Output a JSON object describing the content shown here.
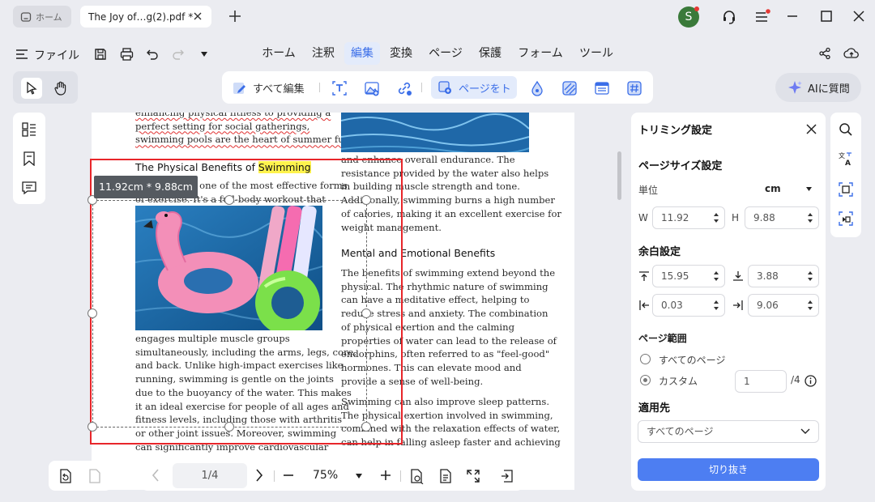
{
  "tabs": {
    "home_label": "ホーム",
    "doc_label": "The Joy of…g(2).pdf *"
  },
  "header": {
    "avatar_letter": "S",
    "accent": "#3b6ee8",
    "avatar_color": "#3a7a3a"
  },
  "file_menu_label": "ファイル",
  "menu": [
    "ホーム",
    "注釈",
    "編集",
    "変換",
    "ページ",
    "保護",
    "フォーム",
    "ツール"
  ],
  "active_menu": "編集",
  "toolbar": {
    "edit_all_label": "すべて編集",
    "page_crop_label": "ページをト"
  },
  "ai_button_label": "AIに質問",
  "document": {
    "col1_top": [
      "enhancing physical fitness to providing a",
      "perfect setting for social gatherings,",
      "swimming pools are the heart of summer fun."
    ],
    "heading1_prefix": "The Physical Benefits of ",
    "heading1_highlight": "Swimming",
    "col1_mid": [
      "Swimming is one of the most effective forms",
      "of exercise. It's a full-body workout that"
    ],
    "col1_bottom": [
      "engages multiple muscle groups",
      "simultaneously, including the arms, legs, core,",
      "and back. Unlike high-impact exercises like",
      "running, swimming is gentle on the joints",
      "due to the buoyancy of the water. This makes",
      "it an ideal exercise for people of all ages and",
      "fitness levels, including those with arthritis",
      "or other joint issues. Moreover, swimming",
      "can significantly improve cardiovascular"
    ],
    "col2_top": [
      "and enhance overall endurance. The",
      "resistance provided by the water also helps",
      "in building muscle strength and tone.",
      "Additionally, swimming burns a high number",
      "of calories, making it an excellent exercise for",
      "weight management."
    ],
    "heading2": "Mental and Emotional Benefits",
    "col2_mid": [
      "The benefits of swimming extend beyond the",
      "physical. The rhythmic nature of swimming",
      "can have a meditative effect, helping to",
      "reduce stress and anxiety. The combination",
      "of physical exertion and the calming",
      "properties of water can lead to the release of",
      "endorphins, often referred to as \"feel-good\"",
      "hormones. This can elevate mood and",
      "provide a sense of well-being."
    ],
    "col2_bottom": [
      "Swimming can also improve sleep patterns.",
      "The physical exertion involved in swimming,",
      "combined with the relaxation effects of water,",
      "can help in falling asleep faster and achieving"
    ],
    "crop_size_label": "11.92cm * 9.88cm"
  },
  "bottom_bar": {
    "page_indicator": "1/4",
    "zoom": "75%"
  },
  "crop_panel": {
    "title": "トリミング設定",
    "page_size_title": "ページサイズ設定",
    "unit_label": "単位",
    "unit_value": "cm",
    "w_label": "W",
    "w_value": "11.92",
    "h_label": "H",
    "h_value": "9.88",
    "margin_title": "余白設定",
    "margin_top": "15.95",
    "margin_bottom": "3.88",
    "margin_left": "0.03",
    "margin_right": "9.06",
    "page_range_title": "ページ範囲",
    "all_pages_label": "すべてのページ",
    "custom_label": "カスタム",
    "custom_value": "1",
    "total_pages": "/4",
    "apply_to_title": "適用先",
    "apply_to_value": "すべてのページ",
    "crop_button_label": "切り抜き"
  }
}
